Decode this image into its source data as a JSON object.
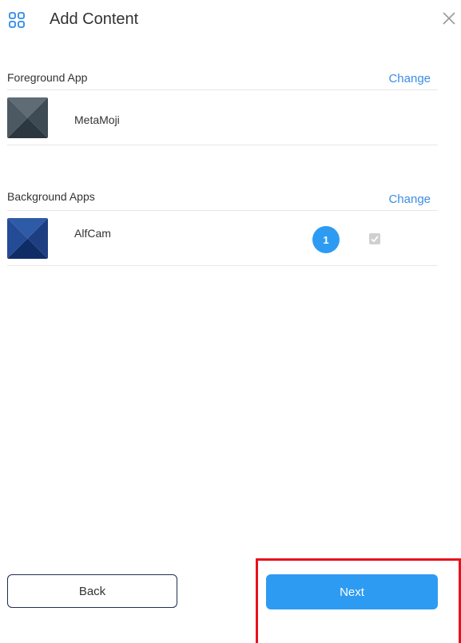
{
  "header": {
    "title": "Add Content",
    "icon": "grid-icon",
    "close_icon": "close-icon"
  },
  "foreground": {
    "label": "Foreground App",
    "change_label": "Change",
    "app": {
      "name": "MetaMoji"
    }
  },
  "background": {
    "label": "Background Apps",
    "change_label": "Change",
    "apps": [
      {
        "name": "AlfCam",
        "order": "1",
        "checked": true
      }
    ]
  },
  "footer": {
    "back_label": "Back",
    "next_label": "Next"
  },
  "colors": {
    "accent": "#2e9bf2",
    "link": "#3b8ee6",
    "highlight": "#e8101b"
  }
}
